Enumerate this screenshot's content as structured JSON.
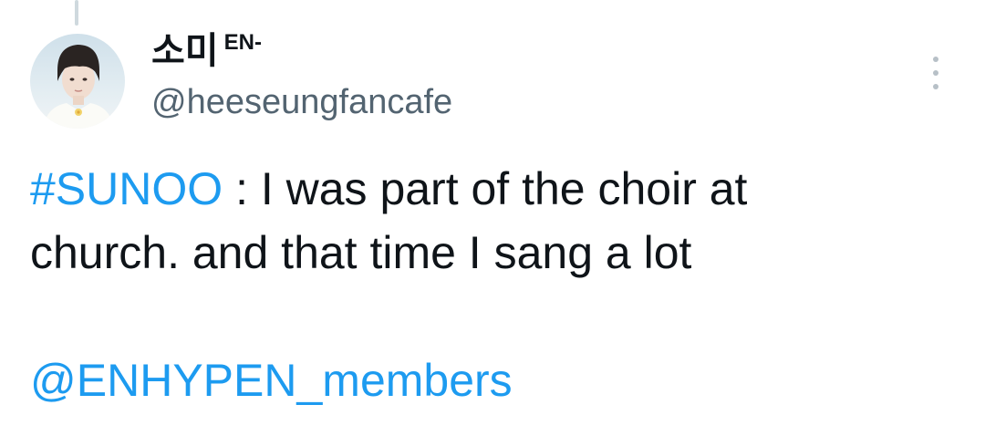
{
  "tweet": {
    "display_name": "소미",
    "display_name_suffix": "EN-",
    "handle": "@heeseungfancafe",
    "hashtag": "#SUNOO",
    "text_part1": " : I was part of the choir at",
    "text_part2": "church. and that time I sang a lot",
    "mention": "@ENHYPEN_members"
  },
  "icons": {
    "avatar": "profile-photo",
    "more": "vertical-ellipsis-icon"
  },
  "colors": {
    "link": "#1d9bf0",
    "text": "#0f1419",
    "secondary": "#536471"
  }
}
